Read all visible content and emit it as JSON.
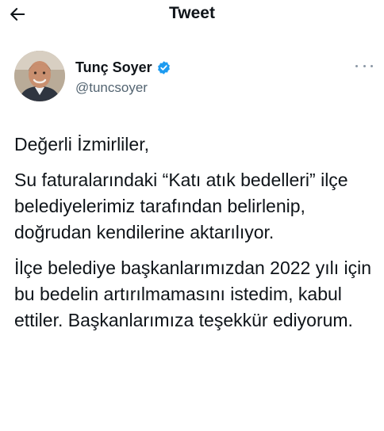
{
  "header": {
    "title": "Tweet",
    "back_icon": "arrow-left-icon"
  },
  "author": {
    "display_name": "Tunç Soyer",
    "handle": "@tuncsoyer",
    "verified": true,
    "verified_color": "#1d9bf0",
    "avatar_icon": "profile-photo"
  },
  "more_icon": "more-horizontal-icon",
  "tweet": {
    "paragraphs": [
      "Değerli İzmirliler,",
      "Su faturalarındaki “Katı atık bedelleri” ilçe belediyelerimiz tarafından belirlenip, doğrudan kendilerine aktarılıyor.",
      "İlçe belediye başkanlarımızdan 2022 yılı için bu bedelin artırılmamasını istedim, kabul ettiler. Başkanlarımıza teşekkür ediyorum."
    ]
  }
}
